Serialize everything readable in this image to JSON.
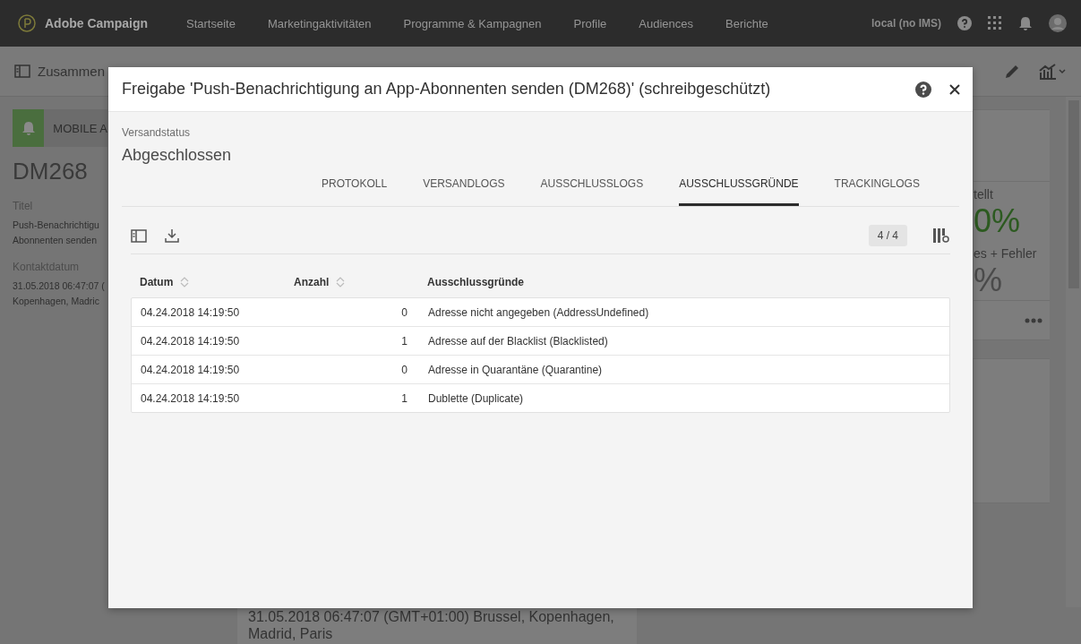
{
  "app_bar": {
    "brand": "Adobe Campaign",
    "nav": [
      "Startseite",
      "Marketingaktivitäten",
      "Programme & Kampagnen",
      "Profile",
      "Audiences",
      "Berichte"
    ],
    "instance": "local (no IMS)"
  },
  "page": {
    "title": "Zusammen",
    "tile_label": "MOBILE A",
    "code": "DM268",
    "fields": [
      {
        "label": "Titel",
        "lines": [
          "Push-Benachrichtigu",
          "Abonnenten senden"
        ]
      },
      {
        "label": "Kontaktdatum",
        "lines": [
          "31.05.2018 06:47:07 (",
          "Kopenhagen, Madric"
        ]
      }
    ],
    "stats": [
      {
        "label": "tellt",
        "value": "0%",
        "color": "#2c5a20"
      },
      {
        "label": "es + Fehler",
        "value": "%",
        "color": "#4a4a4a"
      }
    ],
    "contact_date": "31.05.2018 06:47:07 (GMT+01:00) Brussel, Kopenhagen, Madrid, Paris"
  },
  "dialog": {
    "title": "Freigabe 'Push-Benachrichtigung an App-Abonnenten senden (DM268)' (schreibgeschützt)",
    "status_label": "Versandstatus",
    "status": "Abgeschlossen",
    "tabs": [
      {
        "label": "PROTOKOLL",
        "selected": false
      },
      {
        "label": "VERSANDLOGS",
        "selected": false
      },
      {
        "label": "AUSSCHLUSSLOGS",
        "selected": false
      },
      {
        "label": "AUSSCHLUSSGRÜNDE",
        "selected": true
      },
      {
        "label": "TRACKINGLOGS",
        "selected": false
      }
    ],
    "count": "4 / 4",
    "table": {
      "columns": [
        {
          "label": "Datum",
          "sortable": true
        },
        {
          "label": "Anzahl",
          "sortable": true
        },
        {
          "label": "Ausschlussgründe",
          "sortable": false
        }
      ],
      "rows": [
        [
          "04.24.2018 14:19:50",
          "0",
          "Adresse nicht angegeben (AddressUndefined)"
        ],
        [
          "04.24.2018 14:19:50",
          "1",
          "Adresse auf der Blacklist (Blacklisted)"
        ],
        [
          "04.24.2018 14:19:50",
          "0",
          "Adresse in Quarantäne (Quarantine)"
        ],
        [
          "04.24.2018 14:19:50",
          "1",
          "Dublette (Duplicate)"
        ]
      ]
    }
  }
}
